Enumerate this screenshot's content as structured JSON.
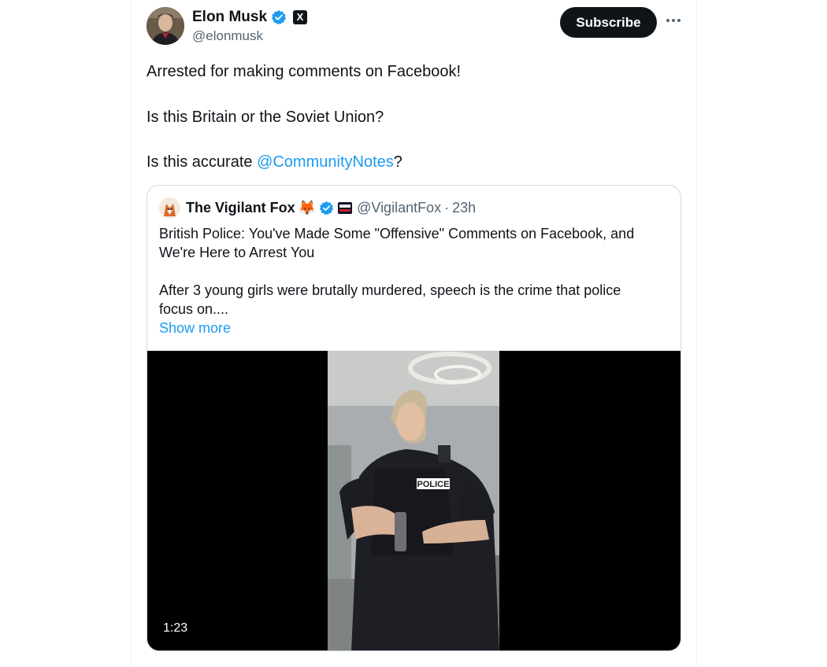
{
  "author": {
    "name": "Elon Musk",
    "handle": "@elonmusk",
    "avatar_icon": "profile-photo",
    "verified_icon": "verified-badge-icon",
    "affiliation_badge": "X"
  },
  "actions": {
    "subscribe_label": "Subscribe",
    "more_icon": "more-icon"
  },
  "tweet": {
    "line1": "Arrested for making comments on Facebook!",
    "line2": "Is this Britain or the Soviet Union?",
    "line3_prefix": "Is this accurate ",
    "line3_mention": "@CommunityNotes",
    "line3_suffix": "?"
  },
  "quote": {
    "name": "The Vigilant Fox",
    "emoji": "🦊",
    "handle": "@VigilantFox",
    "separator": "·",
    "time": "23h",
    "text1a": "British Police: You've Made Some \"Offensive\" Comments on Facebook, and",
    "text1b": "We're Here to Arrest You",
    "text2a": "After 3 young girls were brutally murdered, speech is the crime that police",
    "text2b": "focus on....",
    "show_more": "Show more",
    "video": {
      "duration": "1:23",
      "vest_label": "POLICE"
    }
  },
  "colors": {
    "accent": "#1d9bf0",
    "text": "#0f1419",
    "secondary": "#536471",
    "border": "#cfd9de"
  }
}
